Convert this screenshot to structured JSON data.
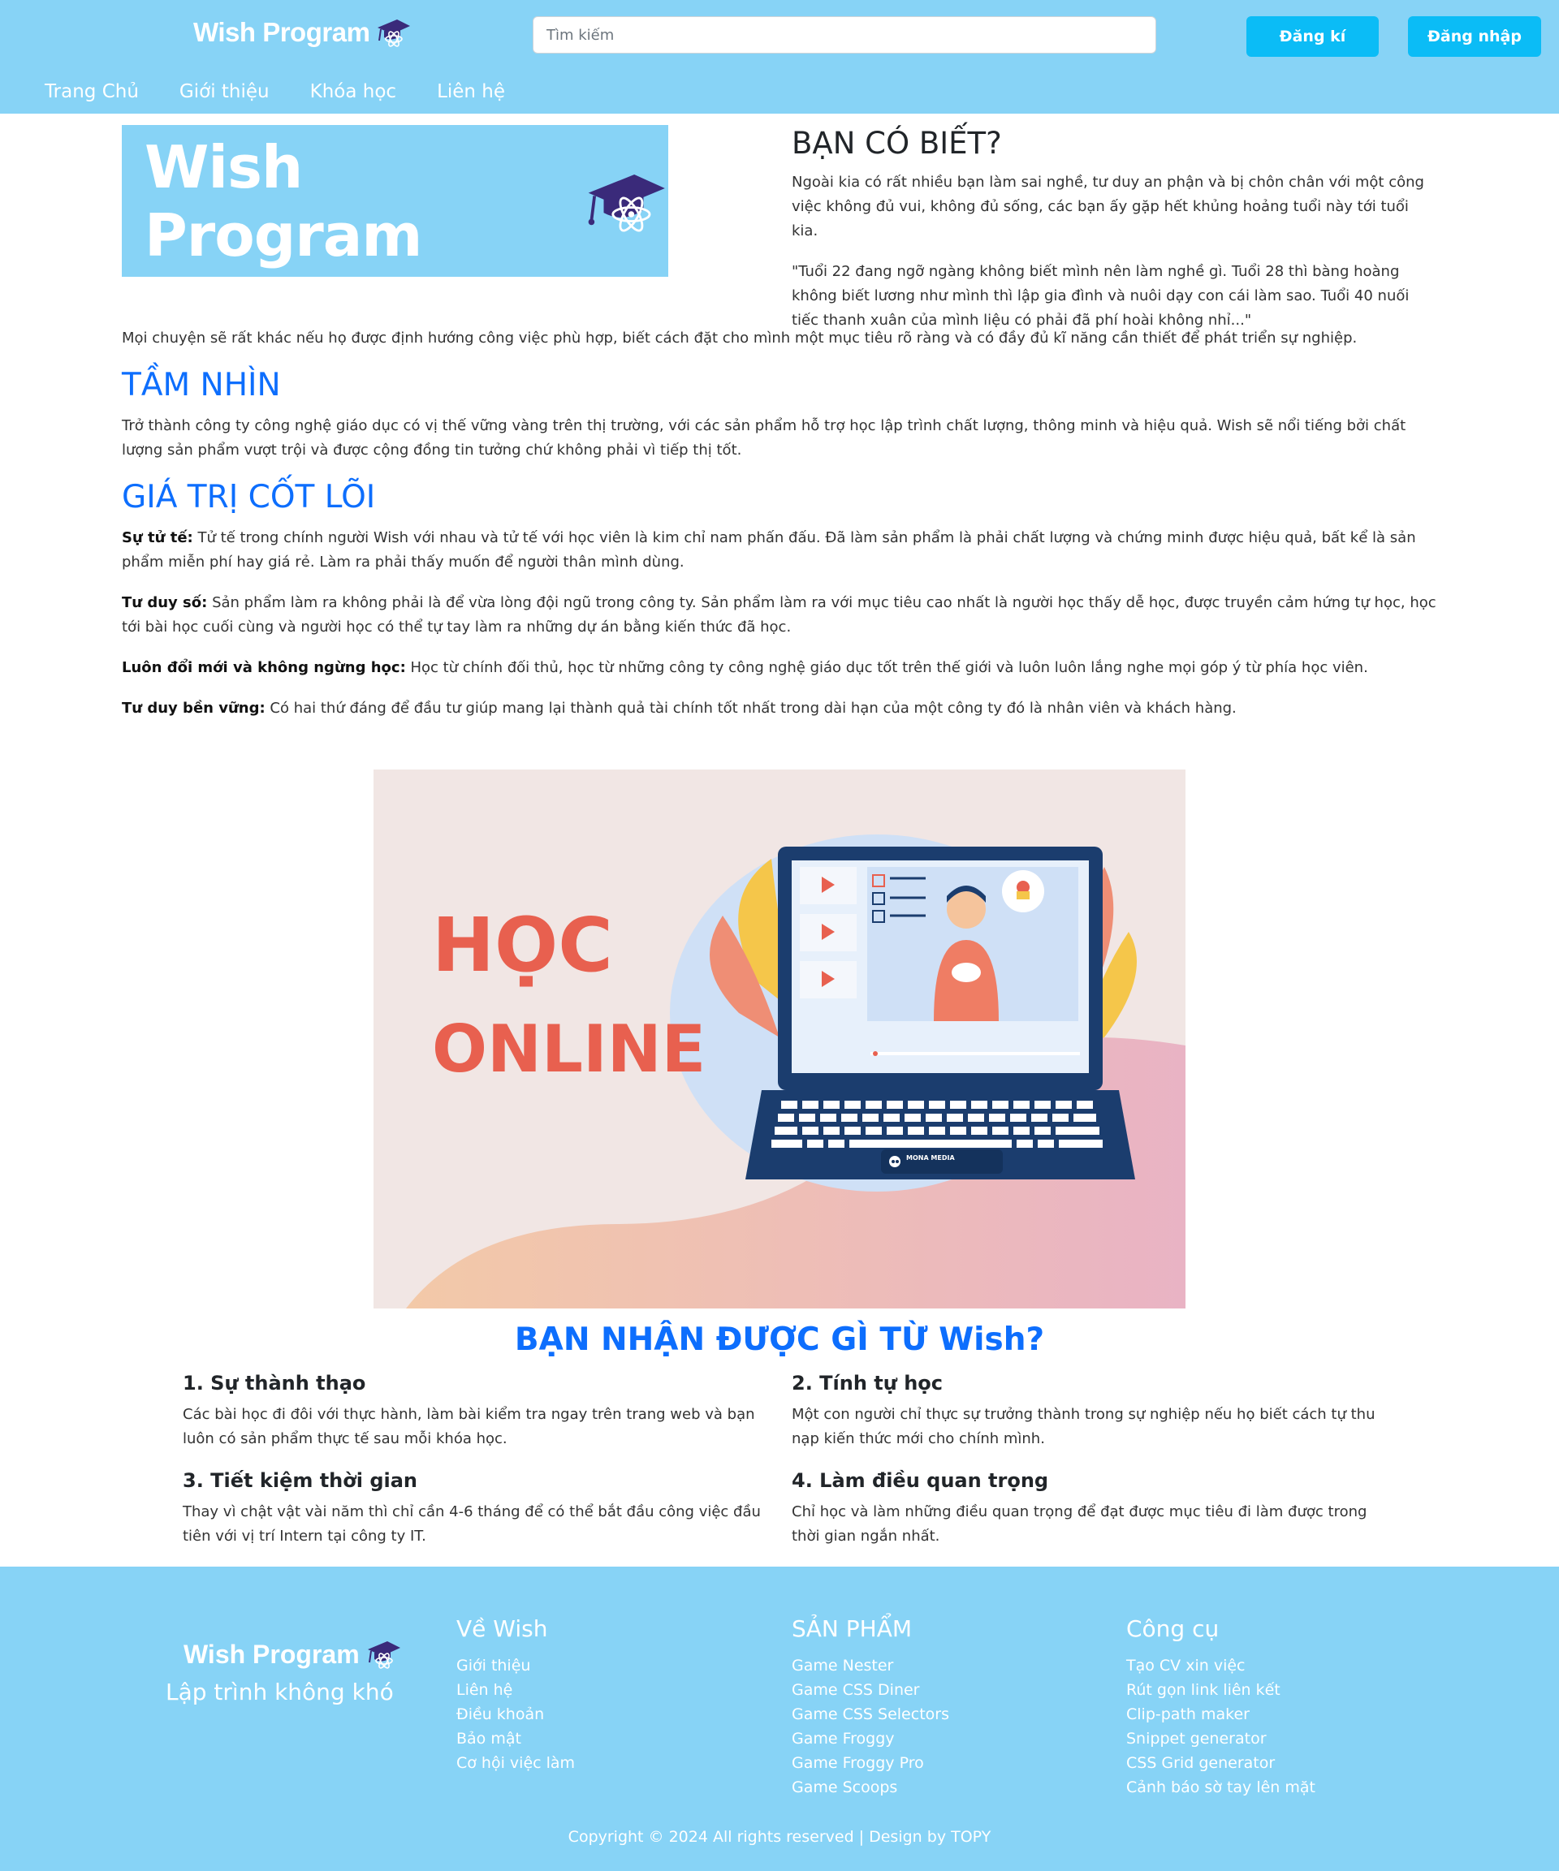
{
  "header": {
    "brand": "Wish Program",
    "search_placeholder": "Tìm kiếm",
    "register_label": "Đăng kí",
    "login_label": "Đăng nhập",
    "nav": [
      "Trang Chủ",
      "Giới thiệu",
      "Khóa học",
      "Liên hệ"
    ]
  },
  "banner": {
    "brand": "Wish Program"
  },
  "intro": {
    "title": "BẠN CÓ BIẾT?",
    "p1": "Ngoài kia có rất nhiều bạn làm sai nghề, tư duy an phận và bị chôn chân với một công việc không đủ vui, không đủ sống, các bạn ấy gặp hết khủng hoảng tuổi này tới tuổi kia.",
    "p2": "\"Tuổi 22 đang ngỡ ngàng không biết mình nên làm nghề gì. Tuổi 28 thì bàng hoàng không biết lương như mình thì lập gia đình và nuôi dạy con cái làm sao. Tuổi 40 nuối tiếc thanh xuân của mình liệu có phải đã phí hoài không nhỉ...\"",
    "p3": "Mọi chuyện sẽ rất khác nếu họ được định hướng công việc phù hợp, biết cách đặt cho mình một mục tiêu rõ ràng và có đầy đủ kĩ năng cần thiết để phát triển sự nghiệp."
  },
  "vision": {
    "title": "TẦM NHÌN",
    "text": "Trở thành công ty công nghệ giáo dục có vị thế vững vàng trên thị trường, với các sản phẩm hỗ trợ học lập trình chất lượng, thông minh và hiệu quả. Wish sẽ nổi tiếng bởi chất lượng sản phẩm vượt trội và được cộng đồng tin tưởng chứ không phải vì tiếp thị tốt."
  },
  "values": {
    "title": "GIÁ TRỊ CỐT LÕI",
    "items": [
      {
        "label": "Sự tử tế:",
        "text": " Tử tế trong chính người Wish với nhau và tử tế với học viên là kim chỉ nam phấn đấu. Đã làm sản phẩm là phải chất lượng và chứng minh được hiệu quả, bất kể là sản phẩm miễn phí hay giá rẻ. Làm ra phải thấy muốn để người thân mình dùng."
      },
      {
        "label": "Tư duy số:",
        "text": " Sản phẩm làm ra không phải là để vừa lòng đội ngũ trong công ty. Sản phẩm làm ra với mục tiêu cao nhất là người học thấy dễ học, được truyền cảm hứng tự học, học tới bài học cuối cùng và người học có thể tự tay làm ra những dự án bằng kiến thức đã học."
      },
      {
        "label": "Luôn đổi mới và không ngừng học:",
        "text": " Học từ chính đối thủ, học từ những công ty công nghệ giáo dục tốt trên thế giới và luôn luôn lắng nghe mọi góp ý từ phía học viên."
      },
      {
        "label": "Tư duy bền vững:",
        "text": " Có hai thứ đáng để đầu tư giúp mang lại thành quả tài chính tốt nhất trong dài hạn của một công ty đó là nhân viên và khách hàng."
      }
    ]
  },
  "illustration": {
    "line1": "HỌC",
    "line2": "ONLINE",
    "laptop_logo": "MONA MEDIA"
  },
  "benefits": {
    "title": "BẠN NHẬN ĐƯỢC GÌ TỪ Wish?",
    "items": [
      {
        "title": "1. Sự thành thạo",
        "text": "Các bài học đi đôi với thực hành, làm bài kiểm tra ngay trên trang web và bạn luôn có sản phẩm thực tế sau mỗi khóa học."
      },
      {
        "title": "2. Tính tự học",
        "text": "Một con người chỉ thực sự trưởng thành trong sự nghiệp nếu họ biết cách tự thu nạp kiến thức mới cho chính mình."
      },
      {
        "title": "3. Tiết kiệm thời gian",
        "text": "Thay vì chật vật vài năm thì chỉ cần 4-6 tháng để có thể bắt đầu công việc đầu tiên với vị trí Intern tại công ty IT."
      },
      {
        "title": "4. Làm điều quan trọng",
        "text": "Chỉ học và làm những điều quan trọng để đạt được mục tiêu đi làm được trong thời gian ngắn nhất."
      }
    ]
  },
  "footer": {
    "brand": "Wish Program",
    "tagline": "Lập trình không khó",
    "columns": [
      {
        "title": "Về Wish",
        "links": [
          "Giới thiệu",
          "Liên hệ",
          "Điều khoản",
          "Bảo mật",
          "Cơ hội việc làm"
        ]
      },
      {
        "title": "SẢN PHẨM",
        "links": [
          "Game Nester",
          "Game CSS Diner",
          "Game CSS Selectors",
          "Game Froggy",
          "Game Froggy Pro",
          "Game Scoops"
        ]
      },
      {
        "title": "Công cụ",
        "links": [
          "Tạo CV xin việc",
          "Rút gọn link liên kết",
          "Clip-path maker",
          "Snippet generator",
          "CSS Grid generator",
          "Cảnh báo sờ tay lên mặt"
        ]
      }
    ],
    "copyright": "Copyright © 2024 All rights reserved | Design by TOPY"
  },
  "colors": {
    "header_bg": "#87d3f6",
    "button_bg": "#0bbcf6",
    "heading_blue": "#0d6efd",
    "illustration_text": "#e8604f",
    "laptop": "#1b3d6e"
  }
}
